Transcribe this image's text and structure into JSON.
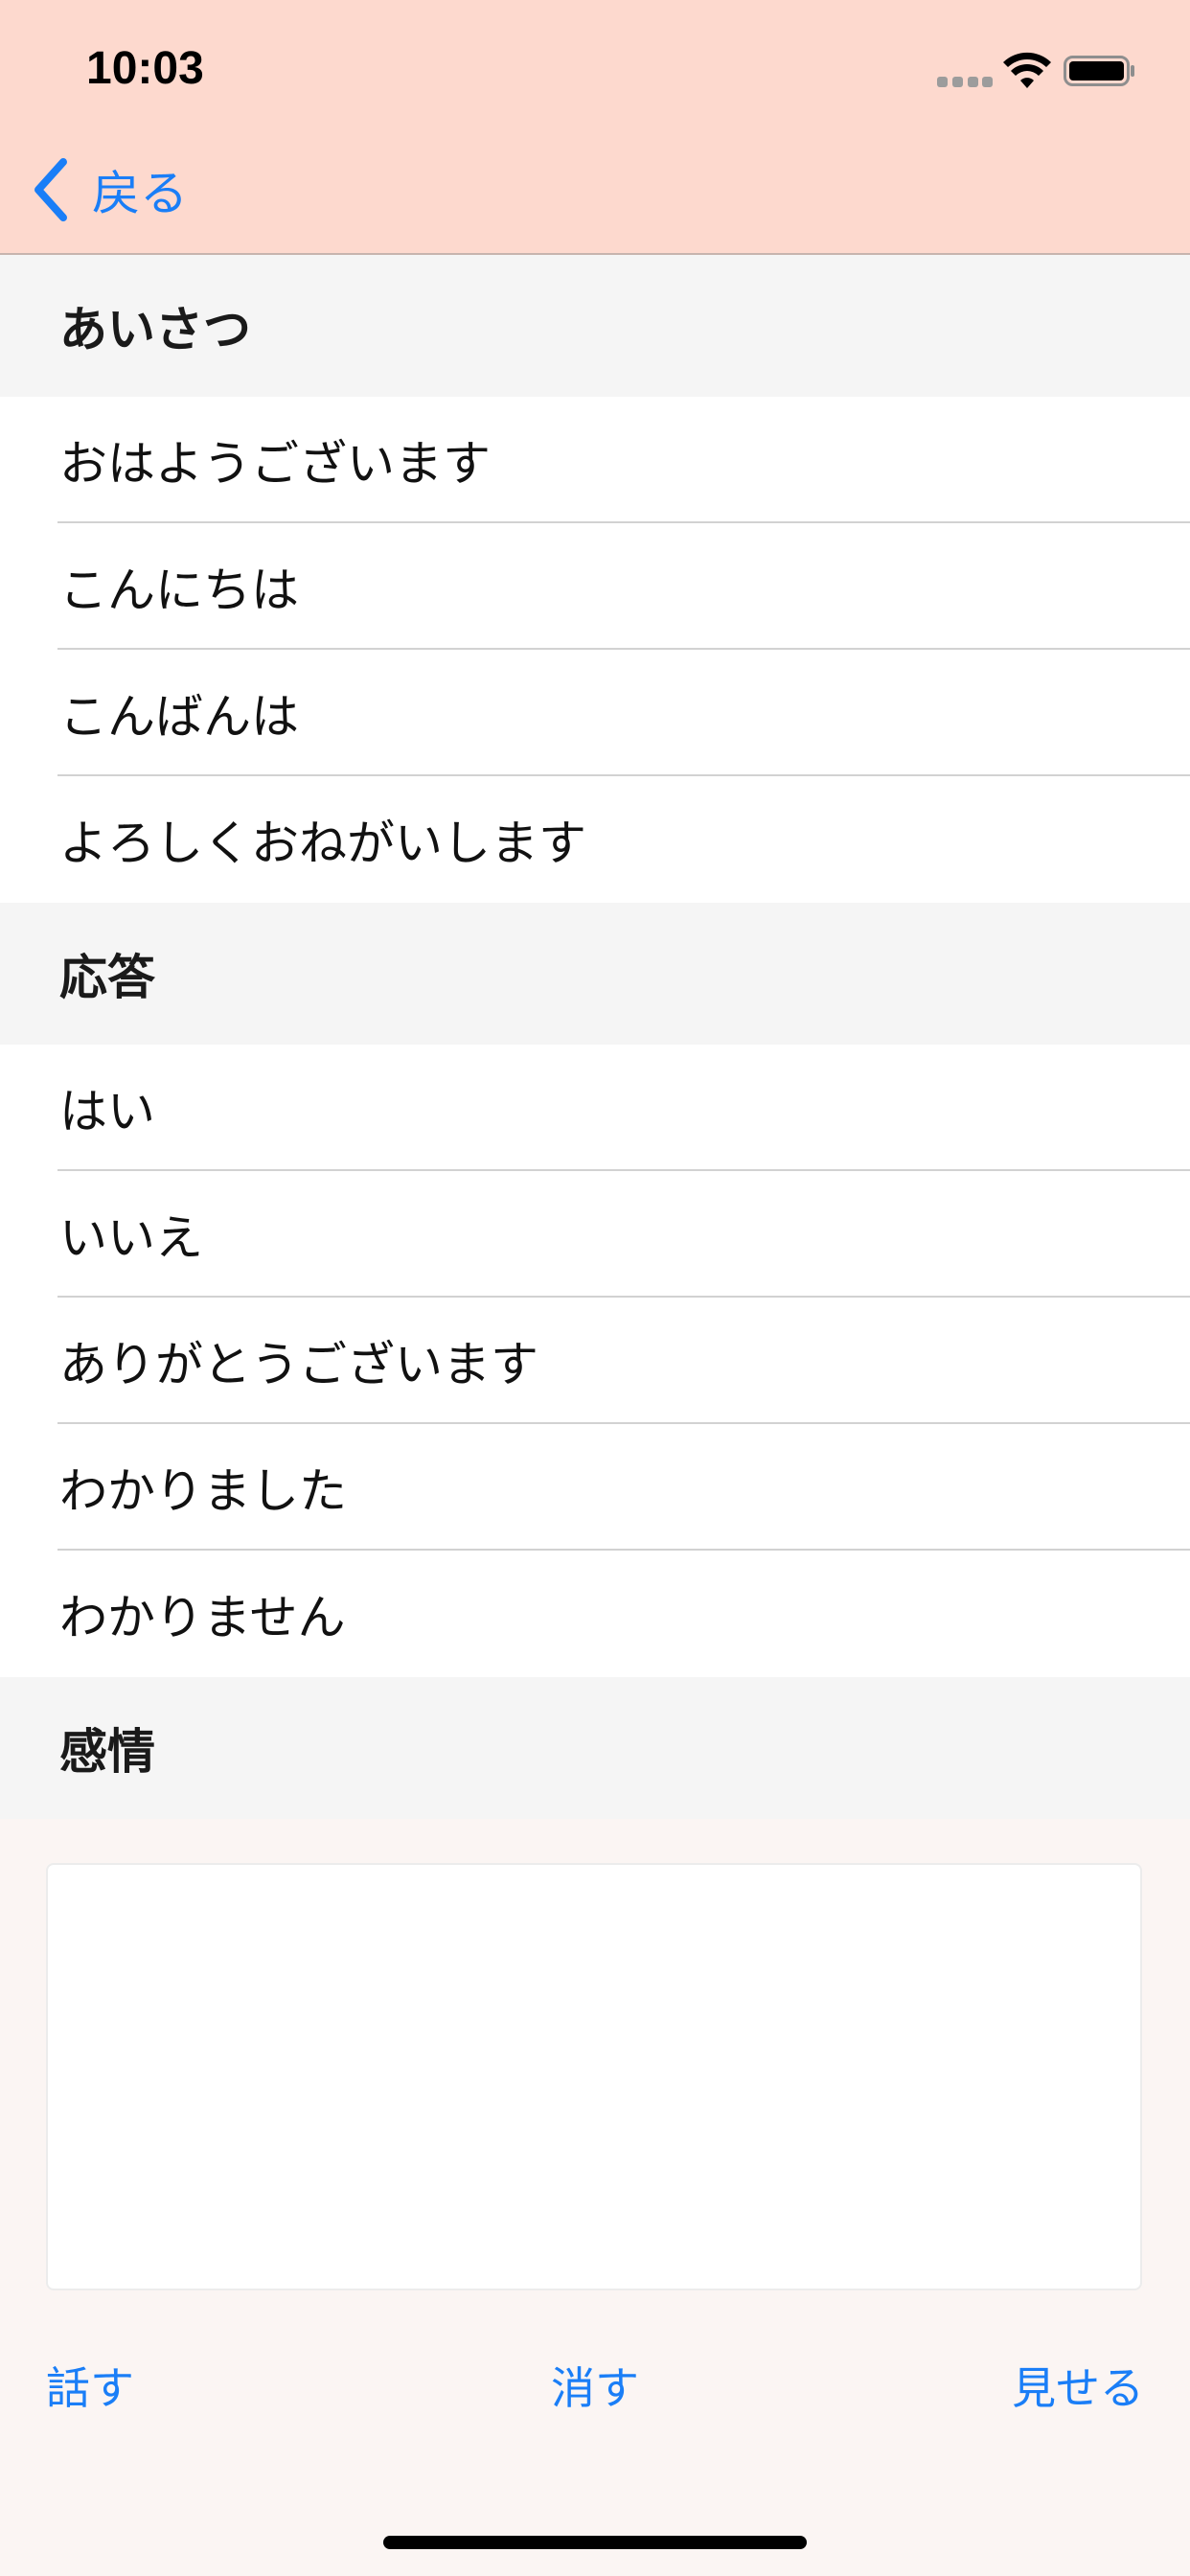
{
  "status_bar": {
    "time": "10:03",
    "signal_icon": "signal-dots-icon",
    "wifi_icon": "wifi-icon",
    "battery_icon": "battery-icon"
  },
  "nav": {
    "back_label": "戻る",
    "back_icon": "chevron-left-icon",
    "accent_color": "#1a7ef7",
    "background_color": "#fdd9ce"
  },
  "sections": [
    {
      "title": "あいさつ",
      "items": [
        "おはようございます",
        "こんにちは",
        "こんばんは",
        "よろしくおねがいします"
      ]
    },
    {
      "title": "応答",
      "items": [
        "はい",
        "いいえ",
        "ありがとうございます",
        "わかりました",
        "わかりません"
      ]
    },
    {
      "title": "感情",
      "items": []
    }
  ],
  "text_area": {
    "value": ""
  },
  "actions": {
    "speak": "話す",
    "clear": "消す",
    "show": "見せる"
  }
}
